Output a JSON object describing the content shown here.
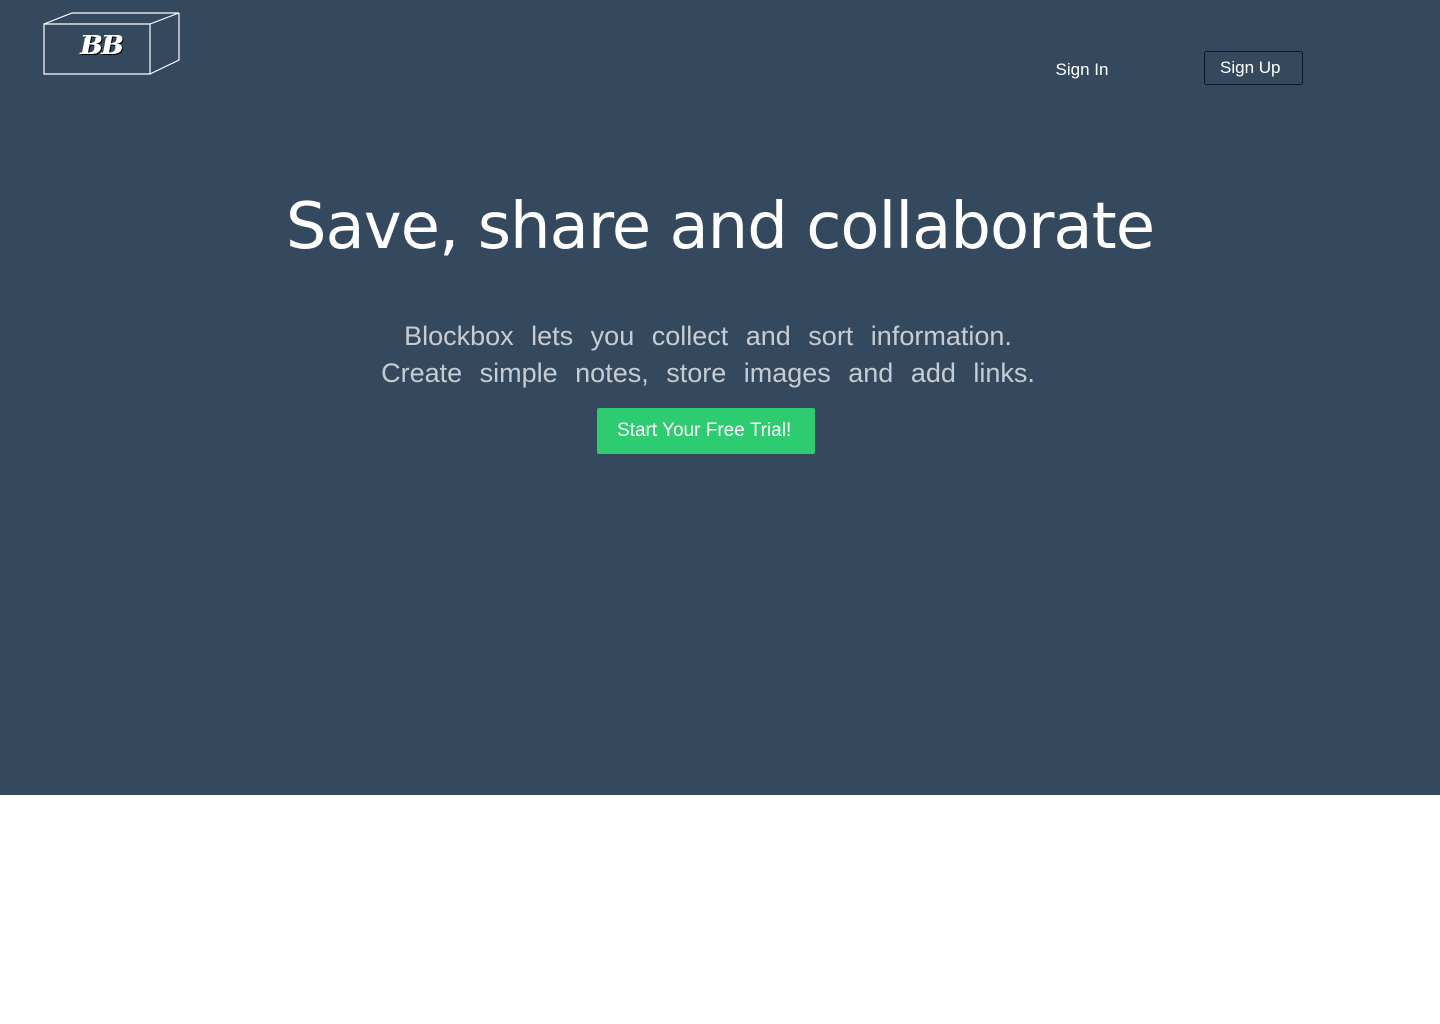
{
  "brand": {
    "logo_text": "BB",
    "logo_icon": "box-icon"
  },
  "nav": {
    "sign_in_label": "Sign In",
    "sign_up_label": "Sign Up"
  },
  "hero": {
    "headline": "Save, share and collaborate",
    "subtext_line_1": "Blockbox lets you collect and sort information.",
    "subtext_line_2": "Create simple notes, store images and add links.",
    "cta_label": "Start Your Free Trial!"
  },
  "colors": {
    "hero_background": "#34495e",
    "cta_background": "#2ecc71",
    "page_background": "#ffffff"
  }
}
